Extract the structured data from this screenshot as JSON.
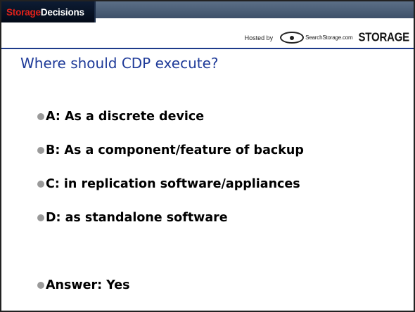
{
  "header": {
    "logo_part1": "Storage",
    "logo_part2": " Decisions",
    "hosted_by": "Hosted by",
    "site": "SearchStorage.com",
    "brand": "STORAGE"
  },
  "slide": {
    "title": "Where should CDP execute?",
    "bullets": [
      "A: As a discrete device",
      "B: As a component/feature of backup",
      "C: in replication software/appliances",
      "D: as standalone software"
    ],
    "answer": "Answer:  Yes"
  }
}
